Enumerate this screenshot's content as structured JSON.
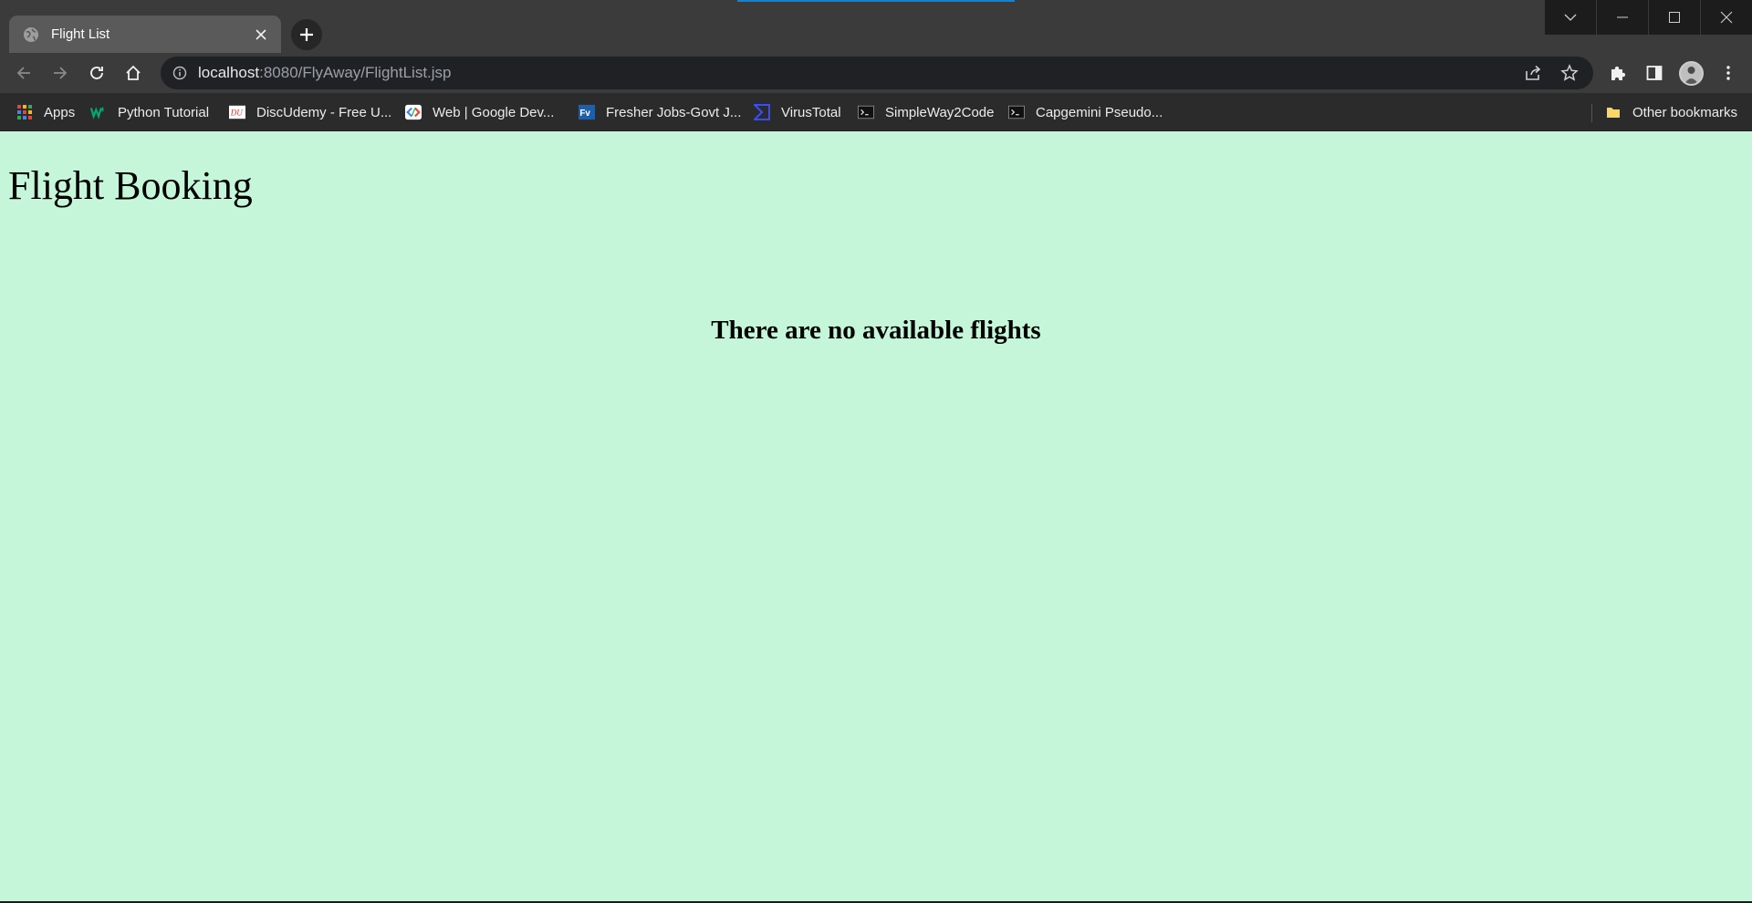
{
  "browser": {
    "tab": {
      "title": "Flight List"
    },
    "address": {
      "host": "localhost",
      "path": ":8080/FlyAway/FlightList.jsp"
    },
    "bookmarks": [
      {
        "label": "Apps",
        "icon": "apps-grid-icon"
      },
      {
        "label": "Python Tutorial",
        "icon": "w3schools-icon"
      },
      {
        "label": "DiscUdemy - Free U...",
        "icon": "discudemy-icon"
      },
      {
        "label": "Web  |  Google Dev...",
        "icon": "google-developers-icon"
      },
      {
        "label": "Fresher Jobs-Govt J...",
        "icon": "fv-icon"
      },
      {
        "label": "VirusTotal",
        "icon": "virustotal-icon"
      },
      {
        "label": "SimpleWay2Code",
        "icon": "terminal-icon"
      },
      {
        "label": "Capgemini Pseudo...",
        "icon": "terminal-icon"
      }
    ],
    "other_bookmarks": {
      "label": "Other bookmarks",
      "icon": "folder-icon"
    }
  },
  "page": {
    "heading": "Flight Booking",
    "message": "There are no available flights"
  },
  "colors": {
    "page_background": "#c6f6d9",
    "chrome_dark": "#3b3b3b",
    "loading_bar": "#0a84d8"
  }
}
